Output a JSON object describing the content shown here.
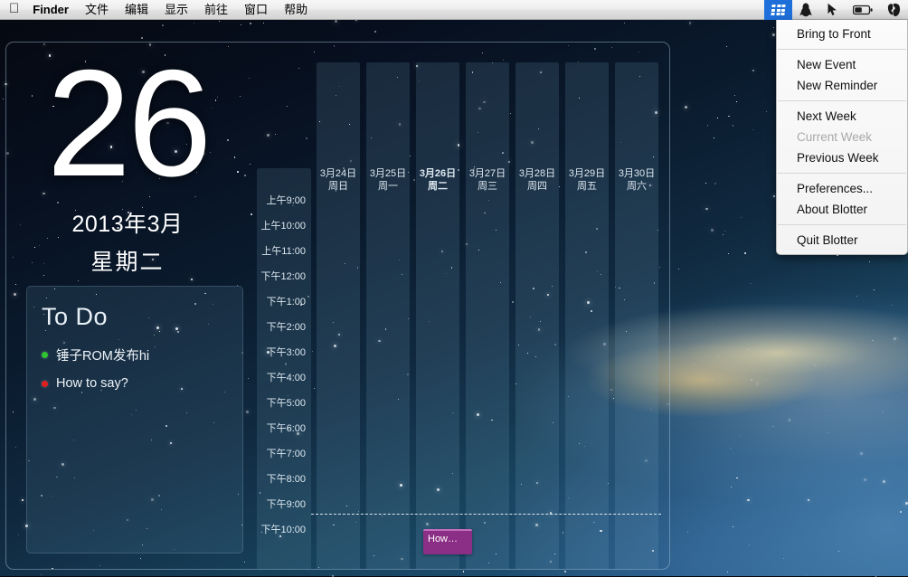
{
  "menubar": {
    "apple_icon": "apple-logo-icon",
    "app_name": "Finder",
    "items": [
      {
        "label": "Finder",
        "bold": true
      },
      {
        "label": "文件",
        "bold": false
      },
      {
        "label": "编辑",
        "bold": false
      },
      {
        "label": "显示",
        "bold": false
      },
      {
        "label": "前往",
        "bold": false
      },
      {
        "label": "窗口",
        "bold": false
      },
      {
        "label": "帮助",
        "bold": false
      }
    ],
    "status_icons": [
      {
        "name": "blotter-grid-icon",
        "active": true
      },
      {
        "name": "qq-penguin-icon",
        "active": false
      },
      {
        "name": "cursor-pointer-icon",
        "active": false
      },
      {
        "name": "battery-icon",
        "active": false
      },
      {
        "name": "evernote-elephant-icon",
        "active": false
      }
    ]
  },
  "blotter_menu": {
    "groups": [
      [
        {
          "label": "Bring to Front",
          "disabled": false
        }
      ],
      [
        {
          "label": "New Event",
          "disabled": false
        },
        {
          "label": "New Reminder",
          "disabled": false
        }
      ],
      [
        {
          "label": "Next Week",
          "disabled": false
        },
        {
          "label": "Current Week",
          "disabled": true
        },
        {
          "label": "Previous Week",
          "disabled": false
        }
      ],
      [
        {
          "label": "Preferences...",
          "disabled": false
        },
        {
          "label": "About Blotter",
          "disabled": false
        }
      ],
      [
        {
          "label": "Quit Blotter",
          "disabled": false
        }
      ]
    ]
  },
  "big_date": {
    "day_number": "26",
    "year_month": "2013年3月",
    "weekday": "星期二"
  },
  "todo": {
    "title": "To Do",
    "items": [
      {
        "text": "锤子ROM发布hi",
        "color": "#2fc42f"
      },
      {
        "text": "How to say?",
        "color": "#e02020"
      }
    ]
  },
  "calendar": {
    "time_labels": [
      "上午9:00",
      "上午10:00",
      "上午11:00",
      "下午12:00",
      "下午1:00",
      "下午2:00",
      "下午3:00",
      "下午4:00",
      "下午5:00",
      "下午6:00",
      "下午7:00",
      "下午8:00",
      "下午9:00",
      "下午10:00"
    ],
    "days": [
      {
        "date": "3月24日",
        "weekday": "周日",
        "today": false
      },
      {
        "date": "3月25日",
        "weekday": "周一",
        "today": false
      },
      {
        "date": "3月26日",
        "weekday": "周二",
        "today": true
      },
      {
        "date": "3月27日",
        "weekday": "周三",
        "today": false
      },
      {
        "date": "3月28日",
        "weekday": "周四",
        "today": false
      },
      {
        "date": "3月29日",
        "weekday": "周五",
        "today": false
      },
      {
        "date": "3月30日",
        "weekday": "周六",
        "today": false
      }
    ],
    "events": [
      {
        "title": "How…",
        "day_index": 2,
        "color": "#8b2f86",
        "accent": "#c66ec0"
      }
    ],
    "current_time_indicator": true
  }
}
